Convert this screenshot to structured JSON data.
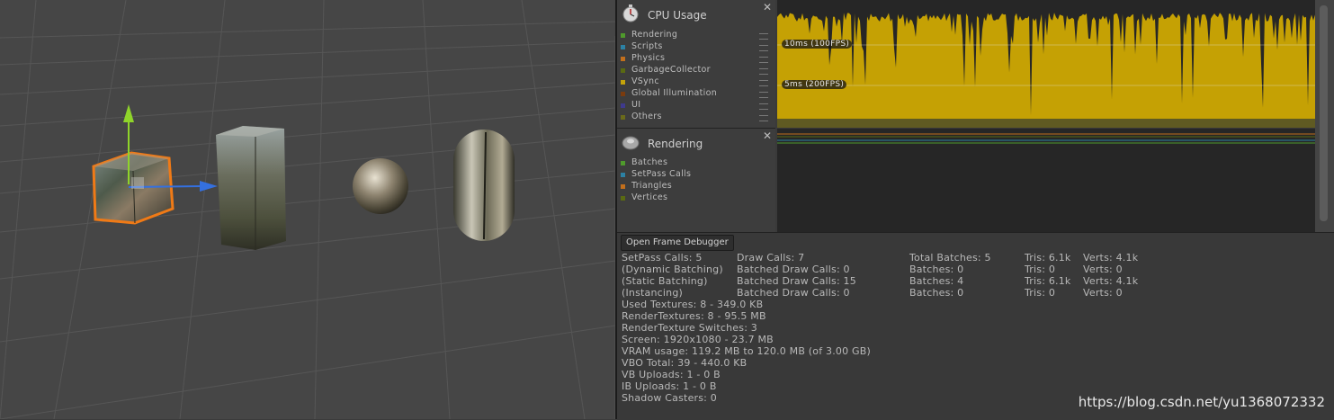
{
  "profiler": {
    "cpu": {
      "title": "CPU Usage",
      "legend": [
        {
          "label": "Rendering",
          "color": "#4f9a2c"
        },
        {
          "label": "Scripts",
          "color": "#2c81a4"
        },
        {
          "label": "Physics",
          "color": "#c26f1c"
        },
        {
          "label": "GarbageCollector",
          "color": "#5a6a12"
        },
        {
          "label": "VSync",
          "color": "#c4a30a"
        },
        {
          "label": "Global Illumination",
          "color": "#7a3b0e"
        },
        {
          "label": "UI",
          "color": "#3f3a8c"
        },
        {
          "label": "Others",
          "color": "#6a6a1a"
        }
      ],
      "marker_10ms": "10ms (100FPS)",
      "marker_5ms": "5ms (200FPS)",
      "chart_fill_color": "#c5a104"
    },
    "rendering": {
      "title": "Rendering",
      "legend": [
        {
          "label": "Batches",
          "color": "#4f9a2c"
        },
        {
          "label": "SetPass Calls",
          "color": "#2c81a4"
        },
        {
          "label": "Triangles",
          "color": "#c26f1c"
        },
        {
          "label": "Vertices",
          "color": "#5a6a12"
        }
      ]
    },
    "open_frame_debugger": "Open Frame Debugger",
    "stats": {
      "col1": [
        "SetPass Calls: 5",
        "(Dynamic Batching)",
        "(Static Batching)",
        "(Instancing)"
      ],
      "col2": [
        "Draw Calls: 7",
        "Batched Draw Calls: 0",
        "Batched Draw Calls: 15",
        "Batched Draw Calls: 0"
      ],
      "col3": [
        "Total Batches: 5",
        "Batches: 0",
        "Batches: 4",
        "Batches: 0"
      ],
      "col4": [
        "Tris: 6.1k",
        "Tris: 0",
        "Tris: 6.1k",
        "Tris: 0"
      ],
      "col5": [
        "Verts: 4.1k",
        "Verts: 0",
        "Verts: 4.1k",
        "Verts: 0"
      ],
      "lines": [
        "Used Textures: 8 - 349.0 KB",
        "RenderTextures: 8 - 95.5 MB",
        "RenderTexture Switches: 3",
        "Screen: 1920x1080 - 23.7 MB",
        "VRAM usage: 119.2 MB to 120.0 MB (of 3.00 GB)",
        "VBO Total: 39 - 440.0 KB",
        "VB Uploads: 1 - 0 B",
        "IB Uploads: 1 - 0 B",
        "Shadow Casters: 0"
      ]
    }
  },
  "watermark": "https://blog.csdn.net/yu1368072332",
  "colors": {
    "selection_outline": "#f07a16",
    "gizmo_y": "#8fd42a",
    "gizmo_x": "#3470e0"
  }
}
